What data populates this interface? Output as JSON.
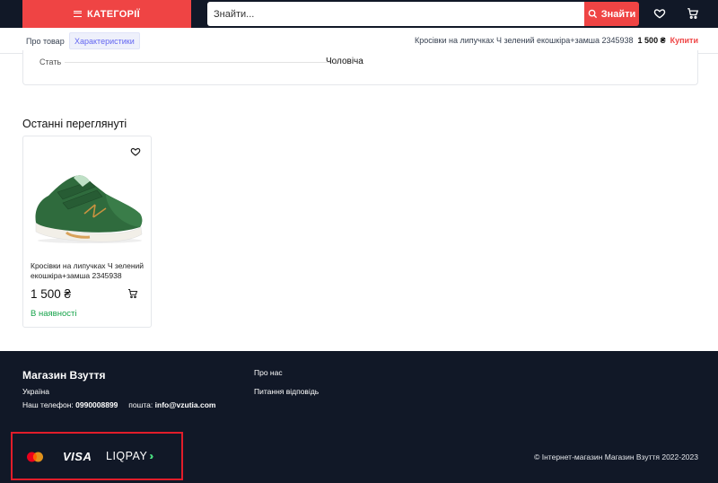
{
  "header": {
    "categories_label": "КАТЕГОРІЇ",
    "search_placeholder": "Знайти...",
    "search_button_label": "Знайти",
    "icons": [
      "menu-icon",
      "search-icon",
      "heart-icon",
      "cart-icon"
    ]
  },
  "subnav": {
    "tabs": [
      {
        "label": "Про товар",
        "active": false
      },
      {
        "label": "Характеристики",
        "active": true
      }
    ],
    "product_name": "Кросівки на липучках Ч зелений екошкіра+замша 2345938",
    "price": "1 500 ₴",
    "buy_label": "Купити"
  },
  "specs": {
    "rows": [
      {
        "label": "Стать",
        "value": "Чоловіча"
      }
    ]
  },
  "recently_viewed": {
    "title": "Останні переглянуті",
    "products": [
      {
        "name": "Кросівки на липучках Ч зелений екошкіра+замша 2345938",
        "price": "1 500 ₴",
        "availability": "В наявності"
      }
    ]
  },
  "footer": {
    "store_name": "Магазин Взуття",
    "country": "Україна",
    "phone_label": "Наш телефон:",
    "phone": "0990008899",
    "email_label": "пошта:",
    "email": "info@vzutia.com",
    "links": [
      "Про нас",
      "Питання відповідь"
    ],
    "payment_logos": [
      "mastercard-logo",
      "VISA",
      "LIQPAY"
    ],
    "copyright": "© Інтернет-магазин Магазин Взуття 2022-2023"
  },
  "colors": {
    "accent": "#ef4444",
    "dark": "#111827",
    "tab_active_bg": "#eef0fb",
    "tab_active_text": "#6366f1",
    "in_stock": "#16a34a",
    "highlight_box": "#e11d2a"
  }
}
